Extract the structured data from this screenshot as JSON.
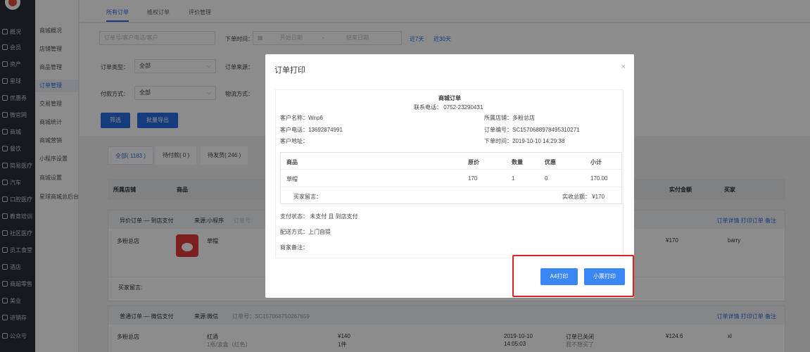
{
  "sidebar_main": [
    {
      "label": "概况",
      "icon": "overview-icon"
    },
    {
      "label": "会员",
      "icon": "member-icon"
    },
    {
      "label": "资产",
      "icon": "asset-icon"
    },
    {
      "label": "星球",
      "icon": "planet-icon"
    },
    {
      "label": "优惠券",
      "icon": "coupon-icon"
    },
    {
      "label": "微官网",
      "icon": "site-icon"
    },
    {
      "label": "商城",
      "icon": "mall-icon"
    },
    {
      "label": "餐饮",
      "icon": "food-icon"
    },
    {
      "label": "简易医疗",
      "icon": "medical-icon"
    },
    {
      "label": "汽车",
      "icon": "car-icon"
    },
    {
      "label": "口腔医疗",
      "icon": "dental-icon"
    },
    {
      "label": "教育培训",
      "icon": "education-icon"
    },
    {
      "label": "社区医疗",
      "icon": "community-icon"
    },
    {
      "label": "员工食堂",
      "icon": "canteen-icon"
    },
    {
      "label": "酒店",
      "icon": "hotel-icon"
    },
    {
      "label": "商超零售",
      "icon": "retail-icon"
    },
    {
      "label": "美业",
      "icon": "beauty-icon"
    },
    {
      "label": "进销存",
      "icon": "inventory-icon"
    },
    {
      "label": "公众号",
      "icon": "wechat-icon"
    }
  ],
  "sidebar_sub": [
    "商城概况",
    "店铺管理",
    "商品管理",
    "订单管理",
    "交易管理",
    "商城统计",
    "商城营销",
    "小程序设置",
    "商城设置",
    "星球商城总后台"
  ],
  "tabs": [
    "所有订单",
    "维权订单",
    "评价管理"
  ],
  "filters": {
    "search_placeholder": "订单号/客户电话/客户",
    "order_time_label": "下单时间：",
    "start_placeholder": "开始日期",
    "dash": "-",
    "end_placeholder": "结束日期",
    "last7": "近7天",
    "last30": "近30天",
    "order_type_label": "订单类型：",
    "order_type_value": "全部",
    "order_source_label": "订单来源：",
    "pay_method_label": "付款方式：",
    "pay_method_value": "全部",
    "logistics_label": "物流方式：",
    "filter_button": "筛选",
    "export_button": "批量导出"
  },
  "status_tabs": [
    "全部( 1183 )",
    "待付款( 0 )",
    "待发货( 246 )"
  ],
  "table_header": {
    "shop": "所属店铺",
    "goods": "商品",
    "paid": "实付金额",
    "buyer": "买家"
  },
  "orders": [
    {
      "type": "异价订单 — 到店支付",
      "source": "来源:小程序",
      "order_no_label": "订单号:",
      "actions": "订单详情  打印订单  备注",
      "shop": "多粉总店",
      "goods": "草帽",
      "paid": "¥170",
      "buyer": "barry",
      "message_label": "买家留言:"
    },
    {
      "type": "普通订单 — 微信支付",
      "source": "来源:微信",
      "order_no": "订单号：SC157068750267659",
      "actions": "订单详情  打印订单  备注",
      "shop": "多粉总店",
      "goods": "红酒",
      "spec": "1瓶/波盒（红色）",
      "price": "¥140",
      "qty": "1件",
      "date": "2019-10-10",
      "time": "14:05:03",
      "status": "订单已关闭",
      "status2": "我不想买了",
      "paid": "¥124.6",
      "buyer": "xl"
    }
  ],
  "modal": {
    "title": "订单打印",
    "close": "×",
    "receipt": {
      "heading": "商城订单",
      "phone": "联系电话：  0752-23290431",
      "customer_name": "客户名称：Wnp6",
      "shop": "所属店铺：多粉总店",
      "customer_phone": "客户电话：13692874991",
      "order_no": "订单编号：SC1570688978495310271",
      "address": "客户地址：",
      "order_time": "下单时间：2019-10-10 14:29:38",
      "table_header": {
        "goods": "商品",
        "price": "原价",
        "qty": "数量",
        "discount": "优惠",
        "subtotal": "小计"
      },
      "item": {
        "goods": "草帽",
        "price": "170",
        "qty": "1",
        "discount": "0",
        "subtotal": "170.00"
      },
      "buyer_message": "买家留言：",
      "total": "实收总额： ¥170",
      "pay_status": "支付状态：  未支付  且  到店支付",
      "delivery": "配送方式：上门自提",
      "merchant_note": "商家备注："
    },
    "btn_a4": "A4打印",
    "btn_small": "小票打印"
  },
  "colors": {
    "primary": "#2b6de4",
    "highlight": "#e02020",
    "sidebar": "#2b2f3a"
  }
}
